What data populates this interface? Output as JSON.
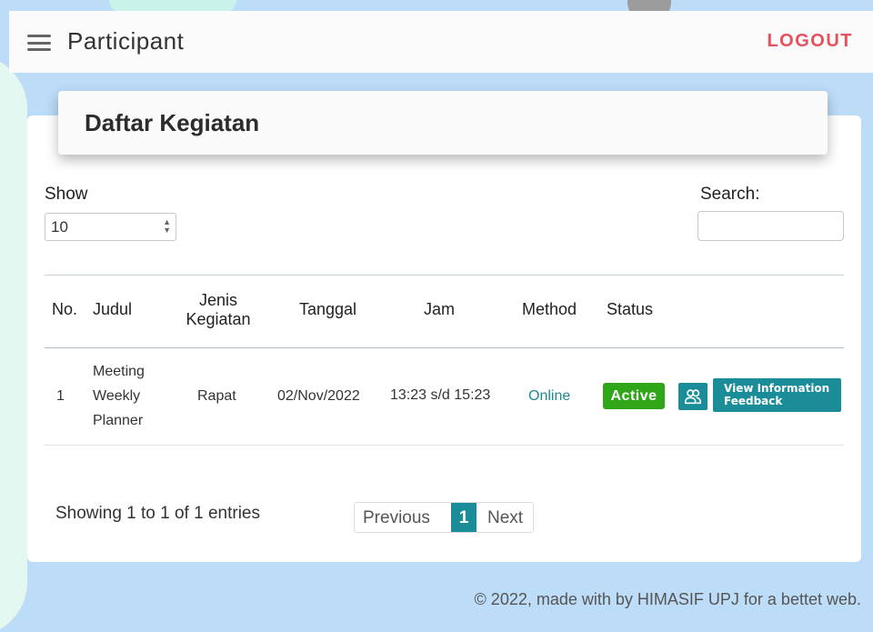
{
  "header": {
    "title": "Participant",
    "logout_label": "LOGOUT"
  },
  "card": {
    "title": "Daftar Kegiatan"
  },
  "controls": {
    "show_label": "Show",
    "show_value": "10",
    "search_label": "Search:",
    "search_value": ""
  },
  "table": {
    "headers": {
      "no": "No.",
      "judul": "Judul",
      "jenis_line1": "Jenis",
      "jenis_line2": "Kegiatan",
      "tanggal": "Tanggal",
      "jam": "Jam",
      "method": "Method",
      "status": "Status"
    },
    "rows": [
      {
        "no": "1",
        "judul_line1": "Meeting",
        "judul_line2": "Weekly",
        "judul_line3": "Planner",
        "jenis": "Rapat",
        "tanggal": "02/Nov/2022",
        "jam": "13:23 s/d 15:23",
        "method": "Online",
        "status": "Active",
        "info_line1": "View Information",
        "info_line2": "Feedback"
      }
    ]
  },
  "footer": {
    "showing": "Showing 1 to 1 of 1 entries",
    "previous": "Previous",
    "current_page": "1",
    "next": "Next",
    "copyright": "© 2022, made with by HIMASIF UPJ for a bettet web."
  },
  "colors": {
    "accent": "#1b8d99",
    "logout": "#e8505b",
    "status_active": "#2fa617",
    "page_bg": "#bcdcf7"
  },
  "icons": {
    "menu": "hamburger-menu-icon",
    "participants": "users-icon",
    "select_arrows": "sort-arrows-icon"
  }
}
